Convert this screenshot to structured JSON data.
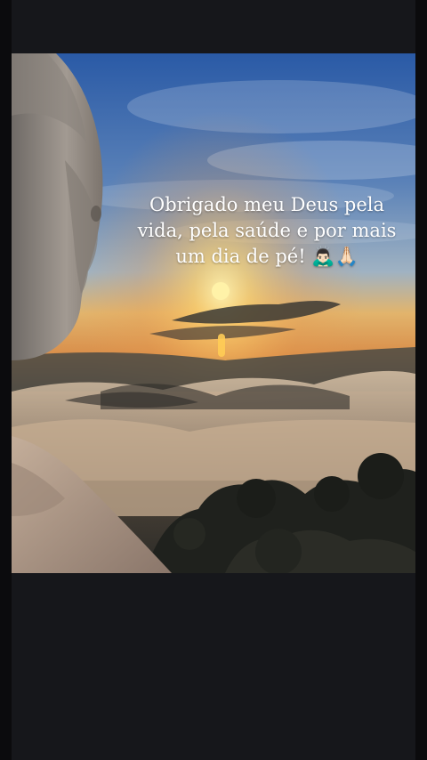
{
  "post": {
    "caption": "Obrigado meu Deus pela vida, pela saúde e por mais um dia de pé! 🙇🏻‍♂️🙏🏻"
  },
  "image": {
    "icons": [
      "bowing-man-emoji",
      "praying-hands-emoji"
    ],
    "colors": {
      "background": "#16171b",
      "sky_top": "#2f5fa8",
      "sun": "#ffd65a",
      "horizon": "#e8a85a"
    }
  }
}
